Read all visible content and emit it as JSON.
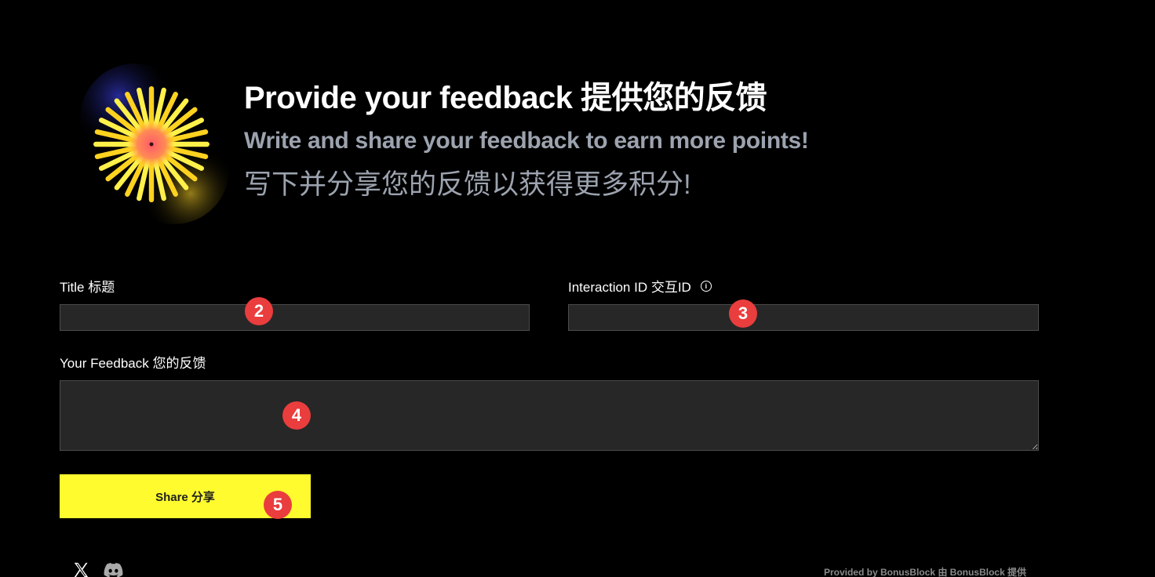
{
  "hero": {
    "title": "Provide your feedback 提供您的反馈",
    "subtitle": "Write and share your feedback to earn more points!",
    "subtitle_cn": "写下并分享您的反馈以获得更多积分!"
  },
  "form": {
    "title_label": "Title 标题",
    "title_value": "",
    "interaction_label": "Interaction ID 交互ID",
    "interaction_info_icon": "info-icon",
    "interaction_value": "",
    "feedback_label": "Your Feedback 您的反馈",
    "feedback_value": "",
    "share_label": "Share 分享"
  },
  "badges": {
    "title_badge": "2",
    "interaction_badge": "3",
    "feedback_badge": "4",
    "share_badge": "5"
  },
  "footer": {
    "social": [
      "x-icon",
      "discord-icon"
    ],
    "provided_by": "Provided by BonusBlock 由 BonusBlock 提供"
  },
  "colors": {
    "background": "#000000",
    "accent_yellow": "#fffb2e",
    "field_bg": "#272727",
    "badge_red": "#ea3d3d",
    "subtitle_gray": "#9ca3af"
  }
}
